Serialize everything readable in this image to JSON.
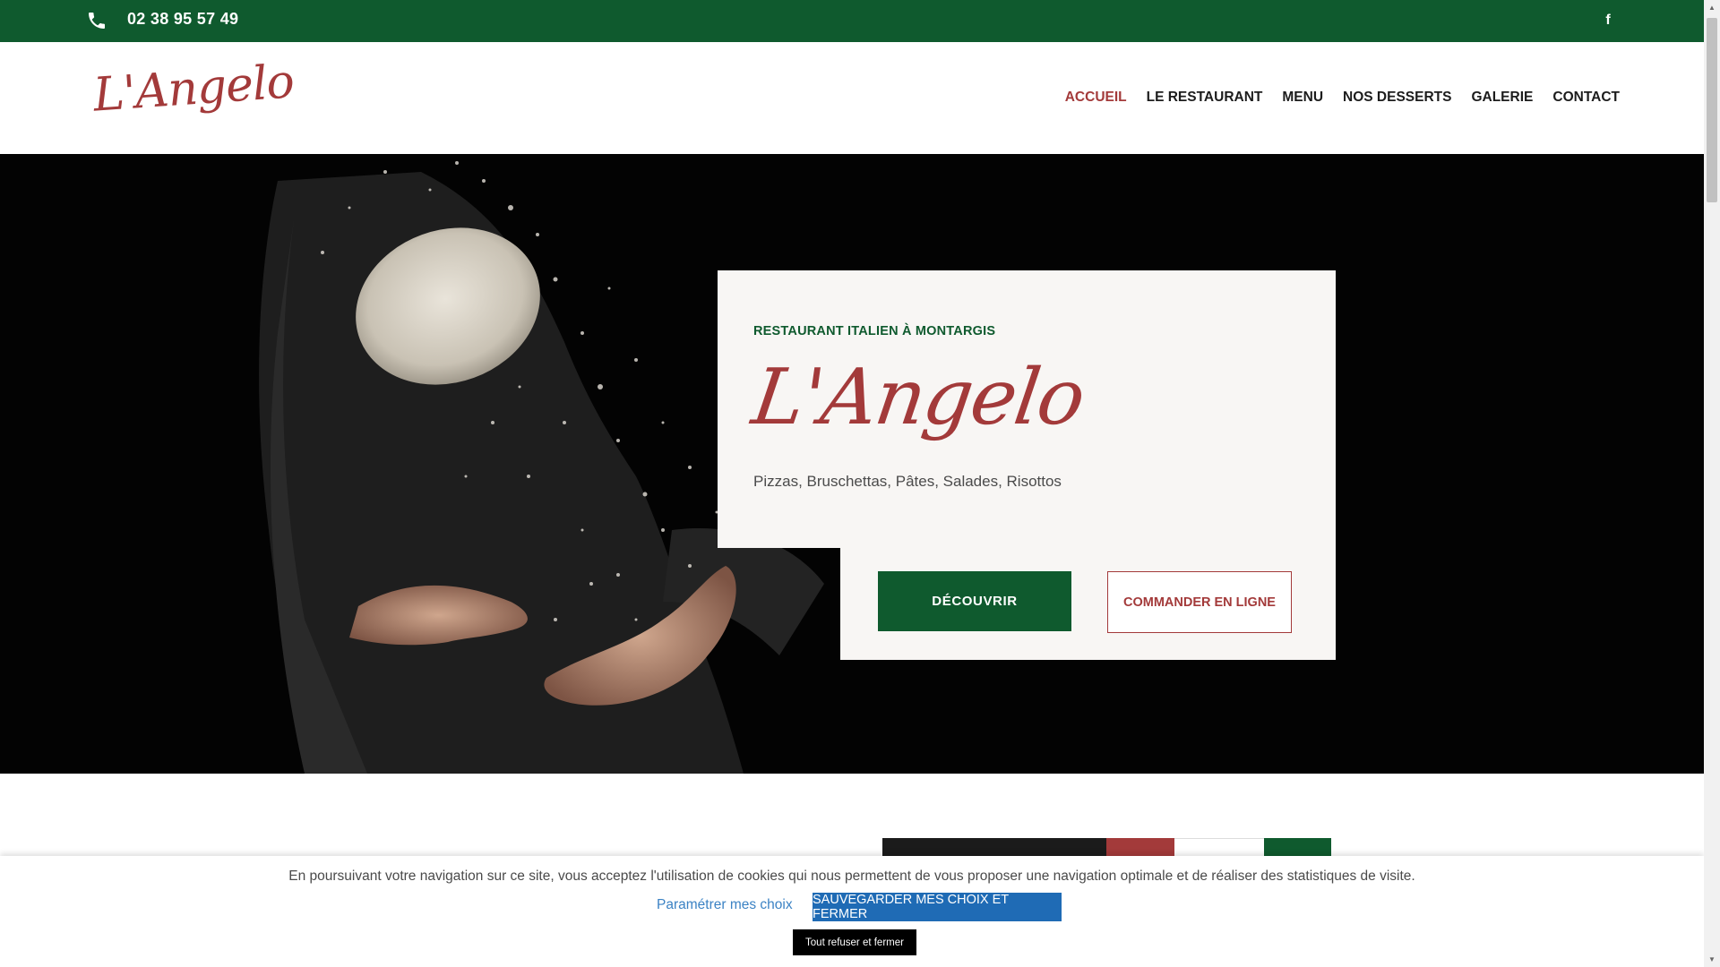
{
  "topbar": {
    "phone": "02 38 95 57 49",
    "phone_icon": "phone-icon",
    "social_icon": "facebook-icon",
    "social_glyph": "f",
    "bg_color": "#0f5a2e"
  },
  "header": {
    "logo_text": "L'Angelo",
    "nav": [
      {
        "label": "ACCUEIL",
        "active": true
      },
      {
        "label": "LE RESTAURANT",
        "active": false
      },
      {
        "label": "MENU",
        "active": false
      },
      {
        "label": "NOS DESSERTS",
        "active": false
      },
      {
        "label": "GALERIE",
        "active": false
      },
      {
        "label": "CONTACT",
        "active": false
      }
    ],
    "accent_color": "#a33a3a"
  },
  "hero": {
    "eyebrow": "RESTAURANT ITALIEN À MONTARGIS",
    "title": "L'Angelo",
    "subtitle": "Pizzas, Bruschettas, Pâtes, Salades, Risottos",
    "discover_label": "DÉCOUVRIR",
    "order_label": "COMMANDER EN LIGNE"
  },
  "cookie": {
    "text": "En poursuivant votre navigation sur ce site, vous acceptez l'utilisation de cookies qui nous permettent de vous proposer une navigation optimale et de réaliser des statistiques de visite.",
    "settings_label": "Paramétrer mes choix",
    "save_label": "SAUVEGARDER MES CHOIX ET FERMER",
    "refuse_label": "Tout refuser et fermer"
  }
}
